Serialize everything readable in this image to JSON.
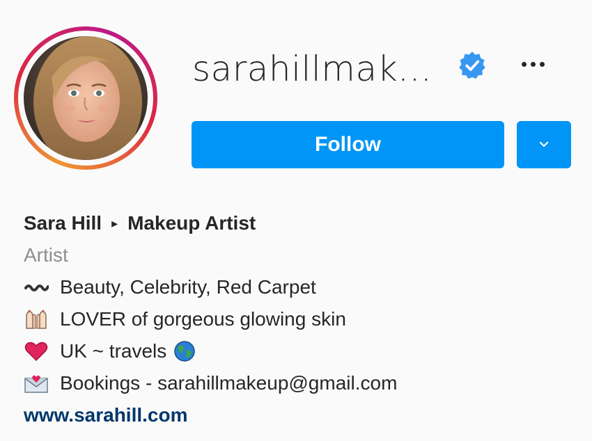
{
  "profile": {
    "username": "sarahillmak...",
    "verified_icon": "verified-badge-icon",
    "more_icon": "more-options-icon"
  },
  "actions": {
    "follow_label": "Follow",
    "dropdown_icon": "chevron-down-icon"
  },
  "bio": {
    "name": "Sara Hill",
    "separator": "▸",
    "title": "Makeup Artist",
    "category": "Artist",
    "lines": [
      {
        "icon": "wavy-dash-icon",
        "text": "Beauty, Celebrity, Red Carpet"
      },
      {
        "icon": "raised-hands-icon",
        "text": "LOVER of gorgeous glowing skin"
      },
      {
        "icon": "heart-icon",
        "text": "UK ~ travels",
        "trailing_icon": "globe-icon"
      },
      {
        "icon": "love-letter-icon",
        "text": "Bookings - sarahillmakeup@gmail.com"
      }
    ],
    "website": "www.sarahill.com"
  },
  "colors": {
    "accent": "#0095f6",
    "link": "#00376b",
    "muted": "#8e8e8e",
    "text": "#262626"
  }
}
